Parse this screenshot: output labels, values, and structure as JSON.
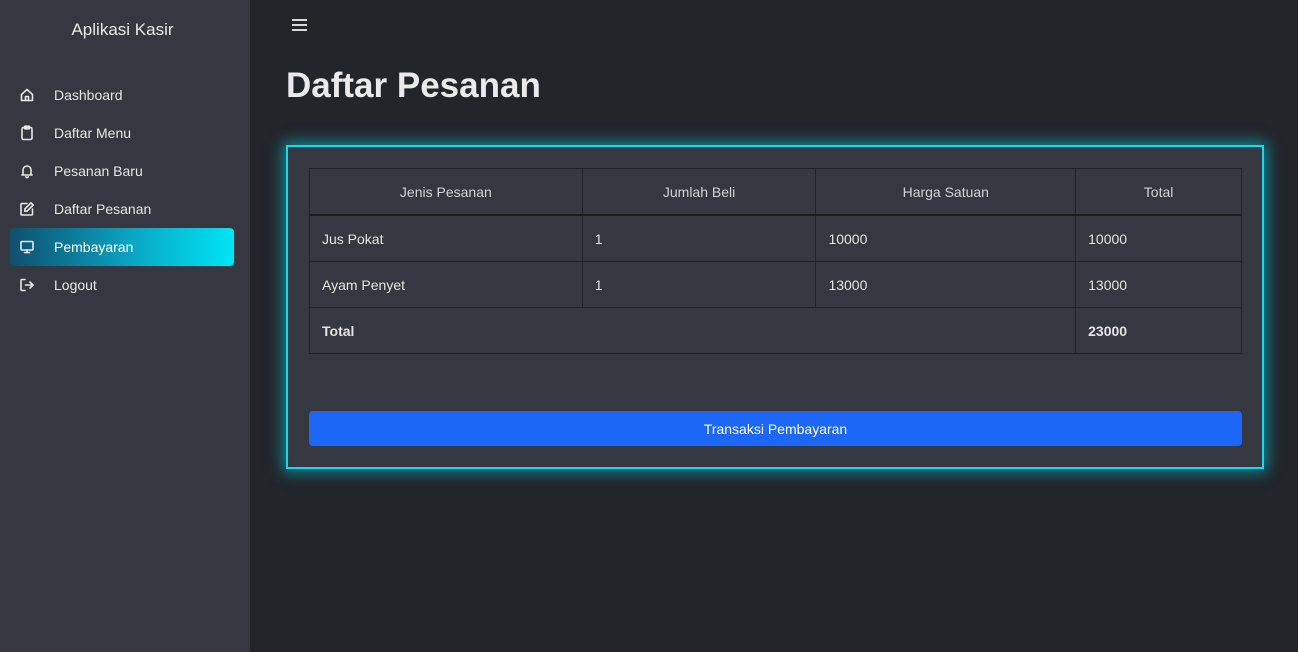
{
  "app": {
    "brand": "Aplikasi Kasir"
  },
  "sidebar": {
    "items": [
      {
        "label": "Dashboard",
        "icon": "home-icon"
      },
      {
        "label": "Daftar Menu",
        "icon": "clipboard-icon"
      },
      {
        "label": "Pesanan Baru",
        "icon": "bell-icon"
      },
      {
        "label": "Daftar Pesanan",
        "icon": "edit-icon"
      },
      {
        "label": "Pembayaran",
        "icon": "monitor-icon",
        "active": true
      },
      {
        "label": "Logout",
        "icon": "logout-icon"
      }
    ]
  },
  "main": {
    "title": "Daftar Pesanan",
    "table": {
      "headers": [
        "Jenis Pesanan",
        "Jumlah Beli",
        "Harga Satuan",
        "Total"
      ],
      "rows": [
        [
          "Jus Pokat",
          "1",
          "10000",
          "10000"
        ],
        [
          "Ayam Penyet",
          "1",
          "13000",
          "13000"
        ]
      ],
      "total_label": "Total",
      "total_value": "23000"
    },
    "pay_button_label": "Transaksi Pembayaran"
  },
  "colors": {
    "sidebar_bg": "#353840",
    "main_bg": "#22252a",
    "accent_glow": "#19d7ec",
    "button": "#1c67f5"
  }
}
